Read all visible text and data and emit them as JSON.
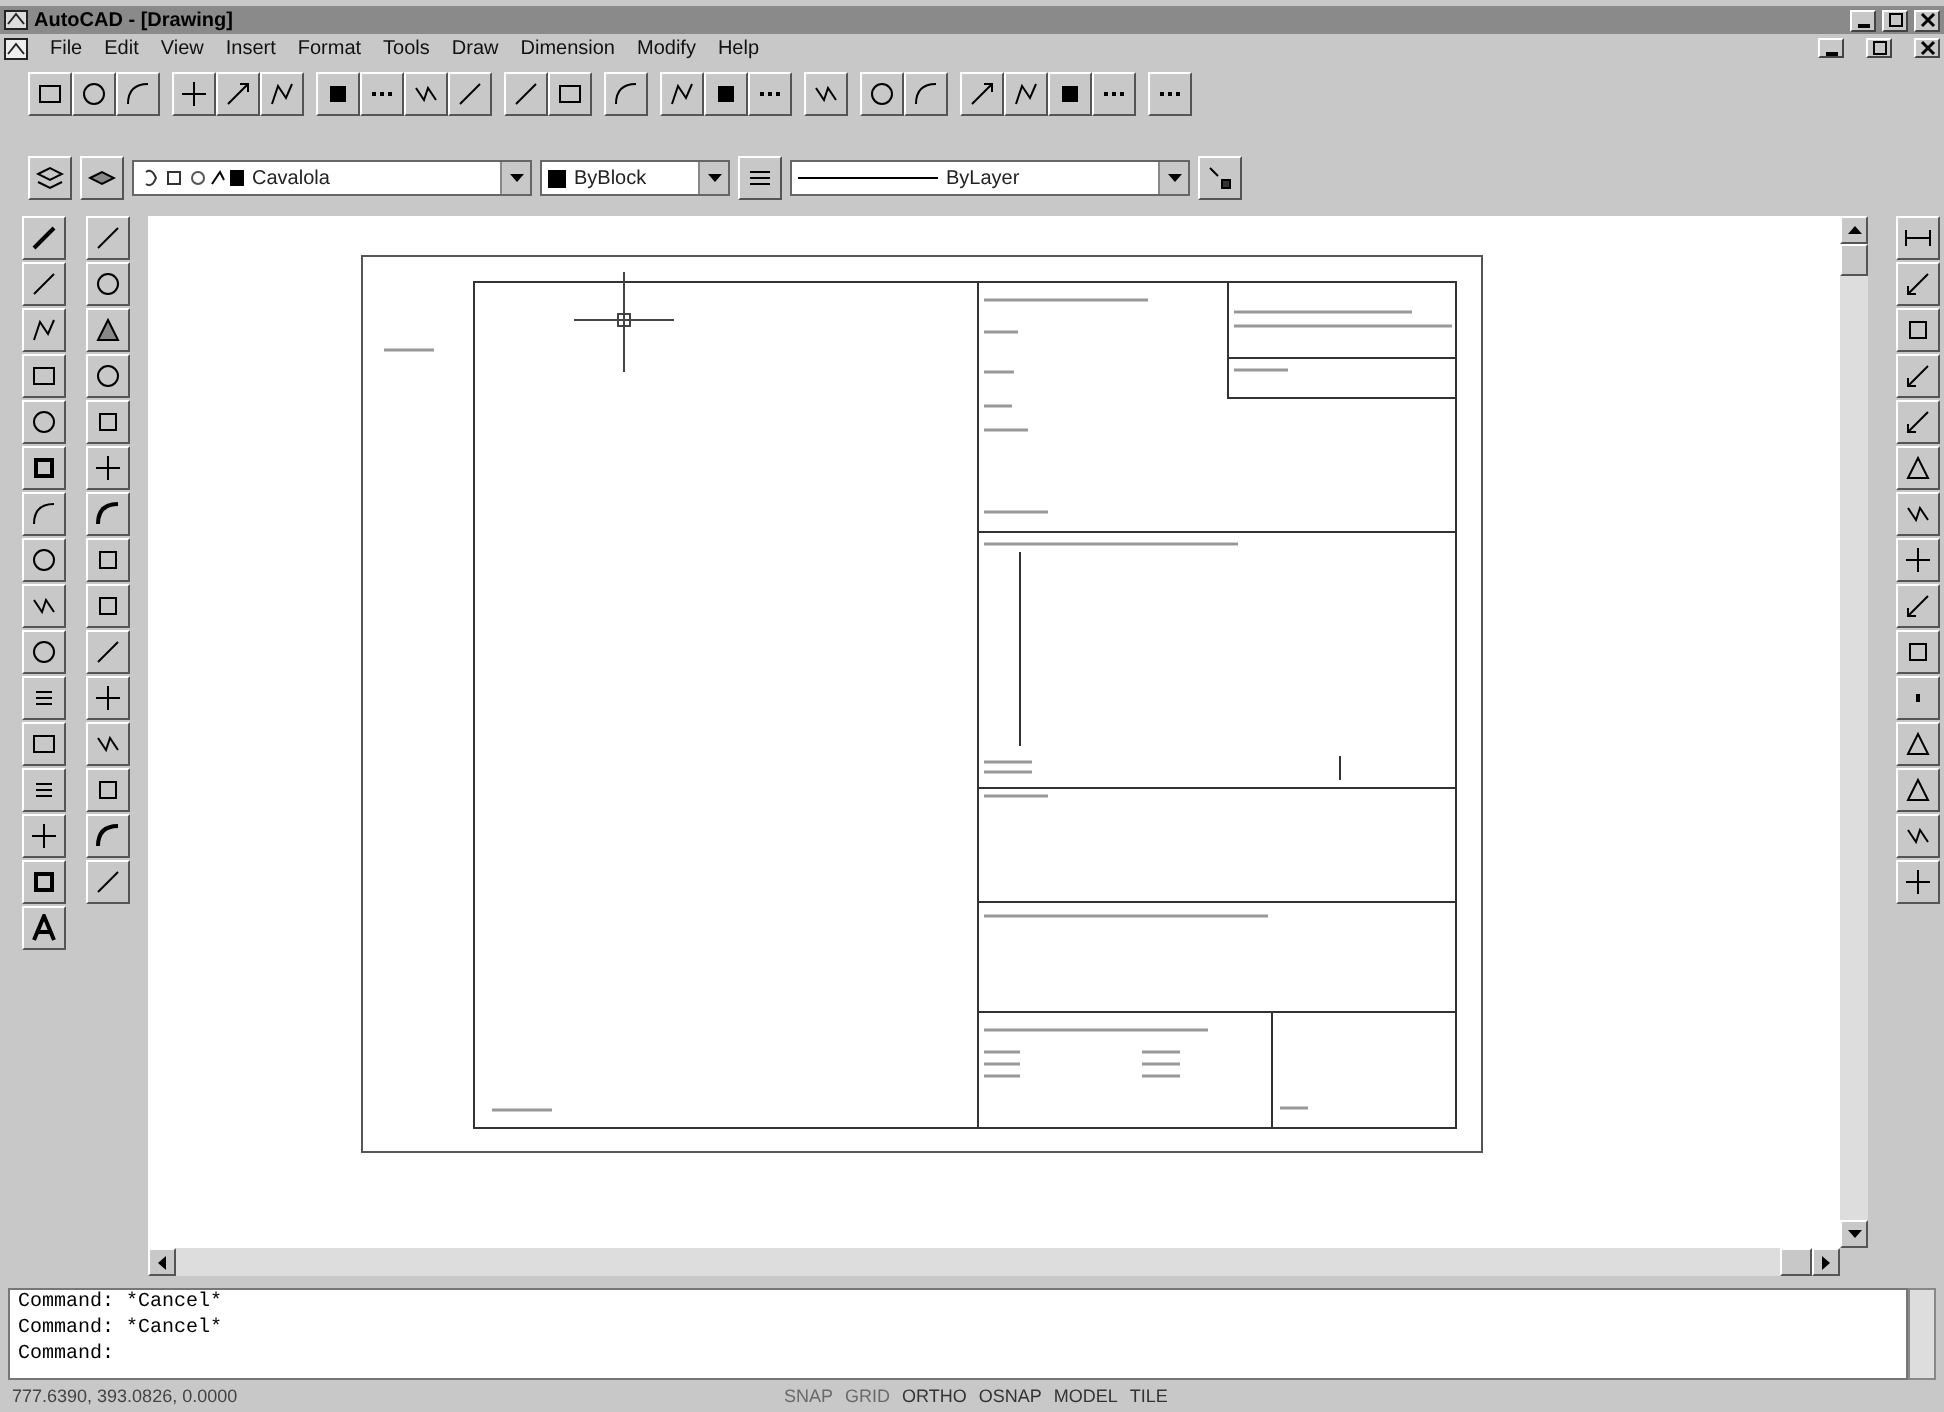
{
  "window": {
    "title": "AutoCAD - [Drawing]"
  },
  "menu": [
    {
      "label": "File"
    },
    {
      "label": "Edit"
    },
    {
      "label": "View"
    },
    {
      "label": "Insert"
    },
    {
      "label": "Format"
    },
    {
      "label": "Tools"
    },
    {
      "label": "Draw"
    },
    {
      "label": "Dimension"
    },
    {
      "label": "Modify"
    },
    {
      "label": "Help"
    }
  ],
  "properties": {
    "layer": "Cavalola",
    "color_control": "ByBlock",
    "linetype": "ByLayer"
  },
  "command_lines": [
    "Command:  *Cancel*",
    "Command:  *Cancel*"
  ],
  "command_prompt": "Command:",
  "status_bar": {
    "coordinates": "777.6390, 393.0826, 0.0000",
    "modes": [
      {
        "label": "SNAP",
        "on": false
      },
      {
        "label": "GRID",
        "on": false
      },
      {
        "label": "ORTHO",
        "on": true
      },
      {
        "label": "OSNAP",
        "on": true
      },
      {
        "label": "MODEL",
        "on": true
      },
      {
        "label": "TILE",
        "on": true
      }
    ]
  }
}
